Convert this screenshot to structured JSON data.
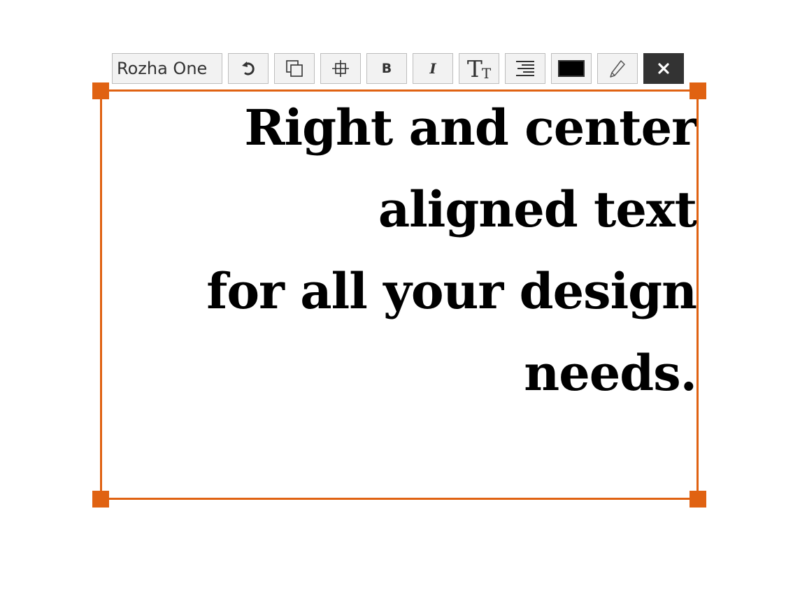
{
  "toolbar": {
    "font_name": "Rozha One",
    "buttons": [
      {
        "name": "rotate-button",
        "icon": "rotate-icon"
      },
      {
        "name": "duplicate-button",
        "icon": "duplicate-icon"
      },
      {
        "name": "position-button",
        "icon": "crosshair-icon"
      },
      {
        "name": "bold-button",
        "icon": "bold-icon",
        "label": "B"
      },
      {
        "name": "italic-button",
        "icon": "italic-icon",
        "label": "I"
      },
      {
        "name": "text-size-button",
        "icon": "text-size-icon",
        "label_big": "T",
        "label_small": "T"
      },
      {
        "name": "align-button",
        "icon": "align-right-icon"
      },
      {
        "name": "color-button",
        "icon": "color-swatch-icon"
      },
      {
        "name": "edit-button",
        "icon": "pencil-icon"
      },
      {
        "name": "close-button",
        "icon": "close-icon"
      }
    ],
    "text_color": "#000000",
    "close_label": "✕"
  },
  "selection": {
    "accent_color": "#e06212"
  },
  "text_box": {
    "lines": [
      "Right and center",
      "aligned text",
      "for all your design",
      "needs."
    ],
    "alignment": "right"
  }
}
